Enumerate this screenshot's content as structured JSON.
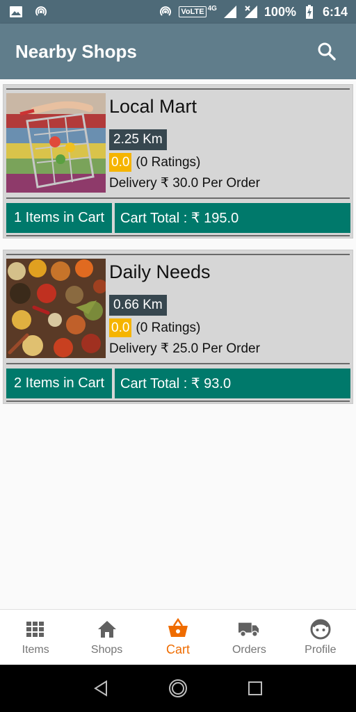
{
  "status_bar": {
    "battery": "100%",
    "time": "6:14",
    "network": "VoLTE",
    "network_gen": "4G"
  },
  "app_bar": {
    "title": "Nearby Shops",
    "search_icon": "search-icon"
  },
  "shops": [
    {
      "name": "Local Mart",
      "image_icon": "shopping-cart-photo",
      "distance": "2.25 Km",
      "rating": "0.0",
      "ratings_text": "(0 Ratings)",
      "delivery": "Delivery ₹ 30.0 Per Order",
      "cart_items": "1 Items in Cart",
      "cart_total": "Cart Total : ₹ 195.0"
    },
    {
      "name": "Daily Needs",
      "image_icon": "spices-photo",
      "distance": "0.66 Km",
      "rating": "0.0",
      "ratings_text": "(0 Ratings)",
      "delivery": "Delivery ₹ 25.0 Per Order",
      "cart_items": "2 Items in Cart",
      "cart_total": "Cart Total : ₹ 93.0"
    }
  ],
  "bottom_nav": [
    {
      "label": "Items",
      "icon": "grid-icon",
      "active": false
    },
    {
      "label": "Shops",
      "icon": "home-icon",
      "active": false
    },
    {
      "label": "Cart",
      "icon": "basket-icon",
      "active": true
    },
    {
      "label": "Orders",
      "icon": "truck-icon",
      "active": false
    },
    {
      "label": "Profile",
      "icon": "face-icon",
      "active": false
    }
  ],
  "colors": {
    "status_bar": "#4e6a78",
    "app_bar": "#607d8b",
    "cart_button": "#00796b",
    "distance_badge": "#37474f",
    "rating_badge": "#f5b400",
    "active_nav": "#ef6c00"
  }
}
